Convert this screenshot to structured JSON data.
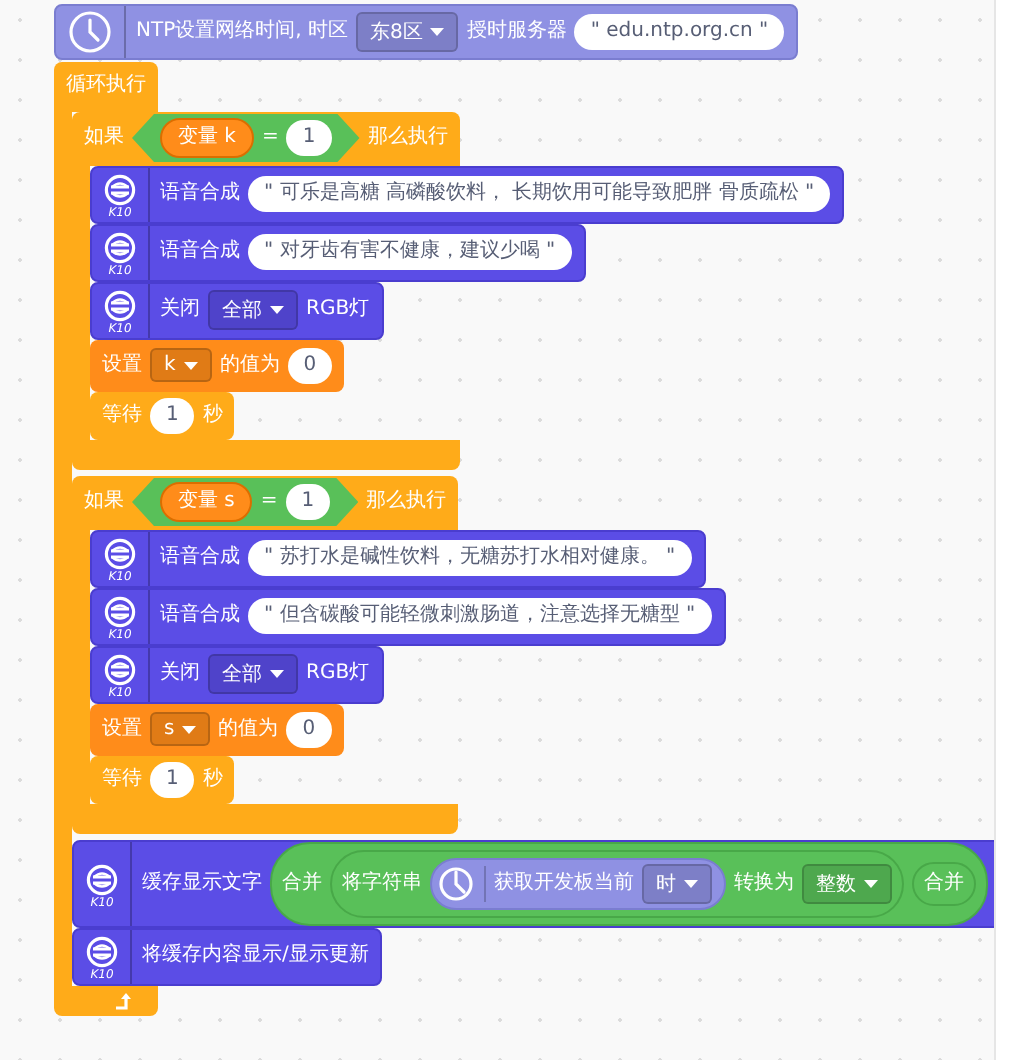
{
  "blocks": [
    {
      "kind": "ntp",
      "parts": [
        {
          "kind": "label",
          "text": "NTP设置网络时间, 时区"
        },
        {
          "kind": "dropdown",
          "text": "东8区"
        },
        {
          "kind": "label",
          "text": "授时服务器"
        },
        {
          "kind": "string",
          "text": "\" edu.ntp.org.cn \""
        }
      ]
    },
    {
      "kind": "loop",
      "parts": [
        {
          "kind": "label",
          "text": "循环执行"
        }
      ],
      "children": [
        {
          "kind": "if",
          "parts": [
            {
              "kind": "label",
              "text": "如果"
            },
            {
              "kind": "condition",
              "parts": [
                {
                  "kind": "variable",
                  "text": "变量 k"
                },
                {
                  "kind": "label",
                  "text": "="
                },
                {
                  "kind": "number",
                  "text": "1"
                }
              ]
            },
            {
              "kind": "label",
              "text": "那么执行"
            }
          ],
          "children": [
            {
              "kind": "board",
              "badge": "K10",
              "parts": [
                {
                  "kind": "label",
                  "text": "语音合成"
                },
                {
                  "kind": "string",
                  "text": "\" 可乐是高糖 高磷酸饮料， 长期饮用可能导致肥胖 骨质疏松 \""
                }
              ]
            },
            {
              "kind": "board",
              "badge": "K10",
              "parts": [
                {
                  "kind": "label",
                  "text": "语音合成"
                },
                {
                  "kind": "string",
                  "text": "\" 对牙齿有害不健康，建议少喝 \""
                }
              ]
            },
            {
              "kind": "board",
              "badge": "K10",
              "parts": [
                {
                  "kind": "label",
                  "text": "关闭"
                },
                {
                  "kind": "dropdown",
                  "text": "全部"
                },
                {
                  "kind": "label",
                  "text": "RGB灯"
                }
              ]
            },
            {
              "kind": "variable",
              "parts": [
                {
                  "kind": "label",
                  "text": "设置"
                },
                {
                  "kind": "dropdown",
                  "text": "k"
                },
                {
                  "kind": "label",
                  "text": "的值为"
                },
                {
                  "kind": "number",
                  "text": "0"
                }
              ]
            },
            {
              "kind": "wait",
              "parts": [
                {
                  "kind": "label",
                  "text": "等待"
                },
                {
                  "kind": "number",
                  "text": "1"
                },
                {
                  "kind": "label",
                  "text": "秒"
                }
              ]
            }
          ]
        },
        {
          "kind": "if",
          "parts": [
            {
              "kind": "label",
              "text": "如果"
            },
            {
              "kind": "condition",
              "parts": [
                {
                  "kind": "variable",
                  "text": "变量 s"
                },
                {
                  "kind": "label",
                  "text": "="
                },
                {
                  "kind": "number",
                  "text": "1"
                }
              ]
            },
            {
              "kind": "label",
              "text": "那么执行"
            }
          ],
          "children": [
            {
              "kind": "board",
              "badge": "K10",
              "parts": [
                {
                  "kind": "label",
                  "text": "语音合成"
                },
                {
                  "kind": "string",
                  "text": "\" 苏打水是碱性饮料，无糖苏打水相对健康。 \""
                }
              ]
            },
            {
              "kind": "board",
              "badge": "K10",
              "parts": [
                {
                  "kind": "label",
                  "text": "语音合成"
                },
                {
                  "kind": "string",
                  "text": "\" 但含碳酸可能轻微刺激肠道，注意选择无糖型 \""
                }
              ]
            },
            {
              "kind": "board",
              "badge": "K10",
              "parts": [
                {
                  "kind": "label",
                  "text": "关闭"
                },
                {
                  "kind": "dropdown",
                  "text": "全部"
                },
                {
                  "kind": "label",
                  "text": "RGB灯"
                }
              ]
            },
            {
              "kind": "variable",
              "parts": [
                {
                  "kind": "label",
                  "text": "设置"
                },
                {
                  "kind": "dropdown",
                  "text": "s"
                },
                {
                  "kind": "label",
                  "text": "的值为"
                },
                {
                  "kind": "number",
                  "text": "0"
                }
              ]
            },
            {
              "kind": "wait",
              "parts": [
                {
                  "kind": "label",
                  "text": "等待"
                },
                {
                  "kind": "number",
                  "text": "1"
                },
                {
                  "kind": "label",
                  "text": "秒"
                }
              ]
            }
          ]
        },
        {
          "kind": "board",
          "badge": "K10",
          "parts": [
            {
              "kind": "label",
              "text": "缓存显示文字"
            },
            {
              "kind": "operator",
              "parts": [
                {
                  "kind": "label",
                  "text": "合并"
                },
                {
                  "kind": "operator",
                  "parts": [
                    {
                      "kind": "label",
                      "text": "将字符串"
                    },
                    {
                      "kind": "time",
                      "parts": [
                        {
                          "kind": "label",
                          "text": "获取开发板当前"
                        },
                        {
                          "kind": "dropdown",
                          "text": "时"
                        }
                      ]
                    },
                    {
                      "kind": "label",
                      "text": "转换为"
                    },
                    {
                      "kind": "dropdown",
                      "text": "整数"
                    }
                  ]
                },
                {
                  "kind": "operator",
                  "parts": [
                    {
                      "kind": "label",
                      "text": "合并"
                    }
                  ]
                }
              ]
            }
          ]
        },
        {
          "kind": "board",
          "badge": "K10",
          "parts": [
            {
              "kind": "label",
              "text": "将缓存内容显示/显示更新"
            }
          ]
        }
      ]
    }
  ]
}
